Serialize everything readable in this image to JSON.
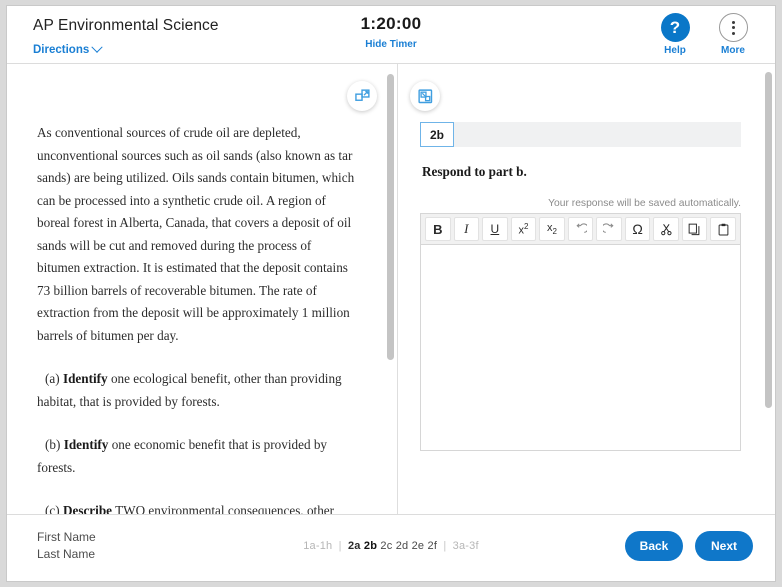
{
  "header": {
    "exam_title": "AP Environmental Science",
    "directions_label": "Directions",
    "directions_icon": "chevron-down-icon",
    "timer_value": "1:20:00",
    "hide_timer_label": "Hide Timer",
    "help_label": "Help",
    "help_icon": "question-mark-icon",
    "more_label": "More",
    "more_icon": "vertical-dots-icon"
  },
  "panels": {
    "left_expand_icon": "expand-panel-icon",
    "right_expand_icon": "collapse-panel-icon"
  },
  "passage": {
    "stimulus": "As conventional sources of crude oil are depleted, unconventional sources such as oil sands (also known as tar sands) are being utilized. Oils sands contain bitumen, which can be processed into a synthetic crude oil. A region of boreal forest in Alberta, Canada, that covers a deposit of oil sands will be cut and removed during the process of bitumen extraction. It is estimated that the deposit contains 73 billion barrels of recoverable bitumen. The rate of extraction from the deposit will be approximately 1 million barrels of bitumen per day.",
    "parts": [
      {
        "marker": "(a)",
        "verb": "Identify",
        "text": " one ecological benefit, other than providing habitat, that is provided by forests."
      },
      {
        "marker": "(b)",
        "verb": "Identify",
        "text": " one economic benefit that is provided by forests."
      },
      {
        "marker": "(c)",
        "verb": "Describe",
        "text": " TWO environmental consequences, other than those related to the loss of boreal forest habitat, that result from the extraction of bitumen or the transportation of synthetic oil to customers."
      }
    ]
  },
  "response": {
    "question_tab": "2b",
    "prompt": "Respond to part b.",
    "autosave_notice": "Your response will be saved automatically.",
    "editor_value": "",
    "toolbar": [
      {
        "name": "bold-button",
        "label": "B",
        "kind": "bold"
      },
      {
        "name": "italic-button",
        "label": "I",
        "kind": "ital"
      },
      {
        "name": "underline-button",
        "label": "U",
        "kind": "und"
      },
      {
        "name": "superscript-button",
        "label": "x²",
        "kind": "sup"
      },
      {
        "name": "subscript-button",
        "label": "x₂",
        "kind": "sub"
      },
      {
        "name": "undo-button",
        "label": "↺",
        "kind": "undo"
      },
      {
        "name": "redo-button",
        "label": "↻",
        "kind": "redo"
      },
      {
        "name": "special-character-button",
        "label": "Ω",
        "kind": "omega"
      },
      {
        "name": "cut-button",
        "label": "✄",
        "kind": "cut"
      },
      {
        "name": "copy-button",
        "label": "⧉",
        "kind": "copy"
      },
      {
        "name": "paste-button",
        "label": "📋",
        "kind": "paste"
      }
    ]
  },
  "footer": {
    "first_name": "First Name",
    "last_name": "Last Name",
    "question_nav": [
      {
        "label": "1a-1h",
        "style": "dim"
      },
      {
        "label": "|",
        "style": "sep"
      },
      {
        "label": "2a",
        "style": "strong"
      },
      {
        "label": "2b",
        "style": "current"
      },
      {
        "label": "2c",
        "style": "norm"
      },
      {
        "label": "2d",
        "style": "norm"
      },
      {
        "label": "2e",
        "style": "norm"
      },
      {
        "label": "2f",
        "style": "norm"
      },
      {
        "label": "|",
        "style": "sep"
      },
      {
        "label": "3a-3f",
        "style": "dim"
      }
    ],
    "back_label": "Back",
    "next_label": "Next"
  },
  "colors": {
    "accent_blue": "#0f77c9",
    "link_blue": "#1a7fd4",
    "tab_border": "#6fb4e8"
  }
}
